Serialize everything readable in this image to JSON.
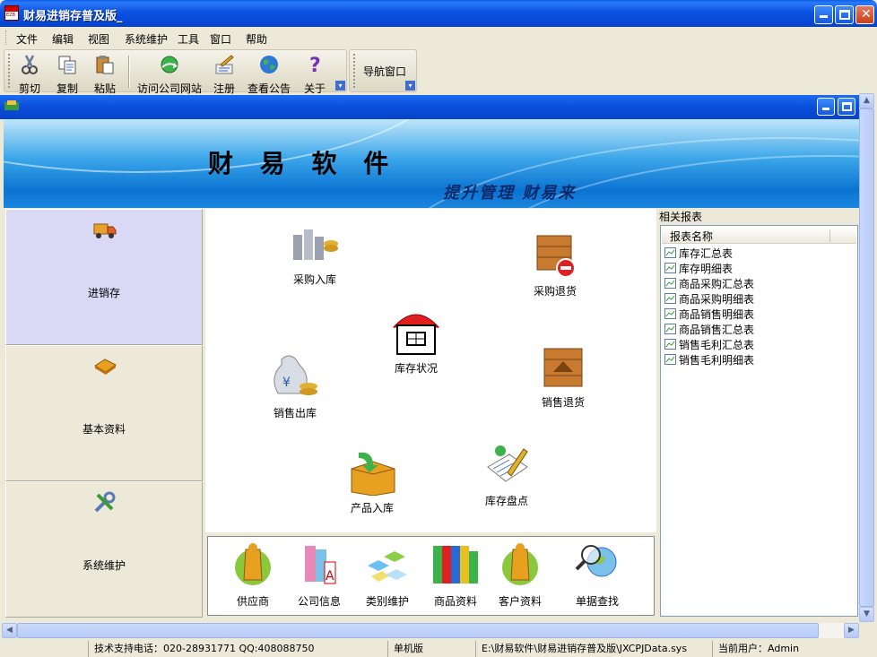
{
  "window": {
    "title": "财易进销存普及版_"
  },
  "menu": [
    "文件",
    "编辑",
    "视图",
    "系统维护",
    "工具",
    "窗口",
    "帮助"
  ],
  "toolbar": {
    "buttons": [
      {
        "label": "剪切",
        "icon": "scissors-icon"
      },
      {
        "label": "复制",
        "icon": "copy-icon"
      },
      {
        "label": "粘贴",
        "icon": "paste-icon"
      },
      {
        "label": "访问公司网站",
        "icon": "globe-arrow-icon"
      },
      {
        "label": "注册",
        "icon": "register-icon"
      },
      {
        "label": "查看公告",
        "icon": "globe-icon"
      },
      {
        "label": "关于",
        "icon": "question-icon"
      }
    ],
    "nav_window": "导航窗口"
  },
  "banner": {
    "wordmark": "财 易 软 件",
    "slogan": "提升管理  财易来"
  },
  "leftnav": [
    {
      "label": "进销存",
      "icon": "truck-icon",
      "active": true
    },
    {
      "label": "基本资料",
      "icon": "book-icon",
      "active": false
    },
    {
      "label": "系统维护",
      "icon": "tools-icon",
      "active": false
    }
  ],
  "center": {
    "purchase_in": "采购入库",
    "purchase_return": "采购退货",
    "stock_status": "库存状况",
    "sales_out": "销售出库",
    "sales_return": "销售退货",
    "product_in": "产品入库",
    "stock_check": "库存盘点"
  },
  "bottom": [
    "供应商",
    "公司信息",
    "类别维护",
    "商品资料",
    "客户资料",
    "单据查找"
  ],
  "reports": {
    "header": "相关报表",
    "column": "报表名称",
    "items": [
      "库存汇总表",
      "库存明细表",
      "商品采购汇总表",
      "商品采购明细表",
      "商品销售明细表",
      "商品销售汇总表",
      "销售毛利汇总表",
      "销售毛利明细表"
    ]
  },
  "status": {
    "support": "技术支持电话：020-28931771 QQ:408088750",
    "edition": "单机版",
    "path": "E:\\财易软件\\财易进销存普及版\\JXCPJData.sys",
    "user": "当前用户：Admin"
  },
  "colors": {
    "titlebar": "#0a4edb",
    "accent": "#3aa5e8",
    "active_nav": "#d9d8f5"
  }
}
